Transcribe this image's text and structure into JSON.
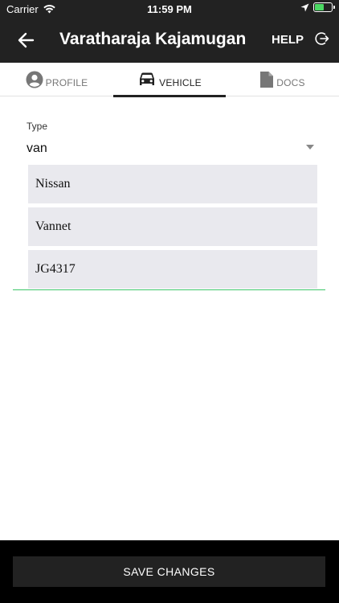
{
  "status_bar": {
    "carrier": "Carrier",
    "time": "11:59 PM",
    "battery_level": 0.6
  },
  "header": {
    "title": "Varatharaja Kajamugan",
    "help_label": "HELP",
    "back_icon": "arrow-left-icon",
    "logout_icon": "logout-icon"
  },
  "tabs": [
    {
      "label": "PROFILE",
      "icon": "account-circle-icon",
      "active": false
    },
    {
      "label": "VEHICLE",
      "icon": "car-icon",
      "active": true
    },
    {
      "label": "DOCS",
      "icon": "document-icon",
      "active": false
    }
  ],
  "vehicle": {
    "type_label": "Type",
    "type_value": "van",
    "make": "Nissan",
    "model": "Vannet",
    "plate": "JG4317"
  },
  "footer": {
    "save_label": "SAVE CHANGES"
  },
  "colors": {
    "header_bg": "#222222",
    "accent_line": "#3ec76a",
    "input_bg": "#e9e9ee",
    "footer_bg": "#000000"
  }
}
